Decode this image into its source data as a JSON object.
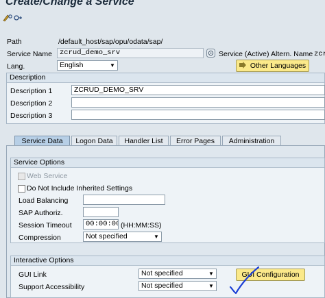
{
  "window": {
    "title": "Create/Change a Service"
  },
  "toolbar": {
    "icons": [
      "display-change-icon",
      "settings-icon"
    ]
  },
  "header": {
    "path_label": "Path",
    "path_value": "/default_host/sap/opu/odata/sap/",
    "service_name_label": "Service Name",
    "service_name_value": "zcrud_demo_srv",
    "service_status": "Service (Active)",
    "altern_name_label": "Altern. Name",
    "altern_name_value": "zcr",
    "lang_label": "Lang.",
    "lang_value": "English",
    "other_languages_button": "Other Languages"
  },
  "description": {
    "heading": "Description",
    "rows": [
      {
        "label": "Description 1",
        "value": "ZCRUD_DEMO_SRV"
      },
      {
        "label": "Description 2",
        "value": ""
      },
      {
        "label": "Description 3",
        "value": ""
      }
    ]
  },
  "tabs": [
    {
      "label": "Service Data",
      "active": true
    },
    {
      "label": "Logon Data",
      "active": false
    },
    {
      "label": "Handler List",
      "active": false
    },
    {
      "label": "Error Pages",
      "active": false
    },
    {
      "label": "Administration",
      "active": false
    }
  ],
  "service_options": {
    "heading": "Service Options",
    "web_service_label": "Web Service",
    "web_service_checked": false,
    "inherit_label": "Do Not Include Inherited Settings",
    "inherit_checked": false,
    "load_balancing_label": "Load Balancing",
    "load_balancing_value": "",
    "sap_authoriz_label": "SAP Authoriz.",
    "sap_authoriz_value": "",
    "session_timeout_label": "Session Timeout",
    "session_timeout_value": "00:00:00",
    "session_timeout_format": "(HH:MM:SS)",
    "compression_label": "Compression",
    "compression_value": "Not specified"
  },
  "interactive_options": {
    "heading": "Interactive Options",
    "gui_link_label": "GUI Link",
    "gui_link_value": "Not specified",
    "support_accessibility_label": "Support Accessibility",
    "support_accessibility_value": "Not specified",
    "gui_configuration_button": "GUI Configuration"
  },
  "colors": {
    "background": "#dfe6ec",
    "group_background": "#eef3f7",
    "button_yellow": "#fbe98a",
    "active_tab": "#b7cfe6",
    "annotation_checkmark": "#1b3fd6"
  }
}
